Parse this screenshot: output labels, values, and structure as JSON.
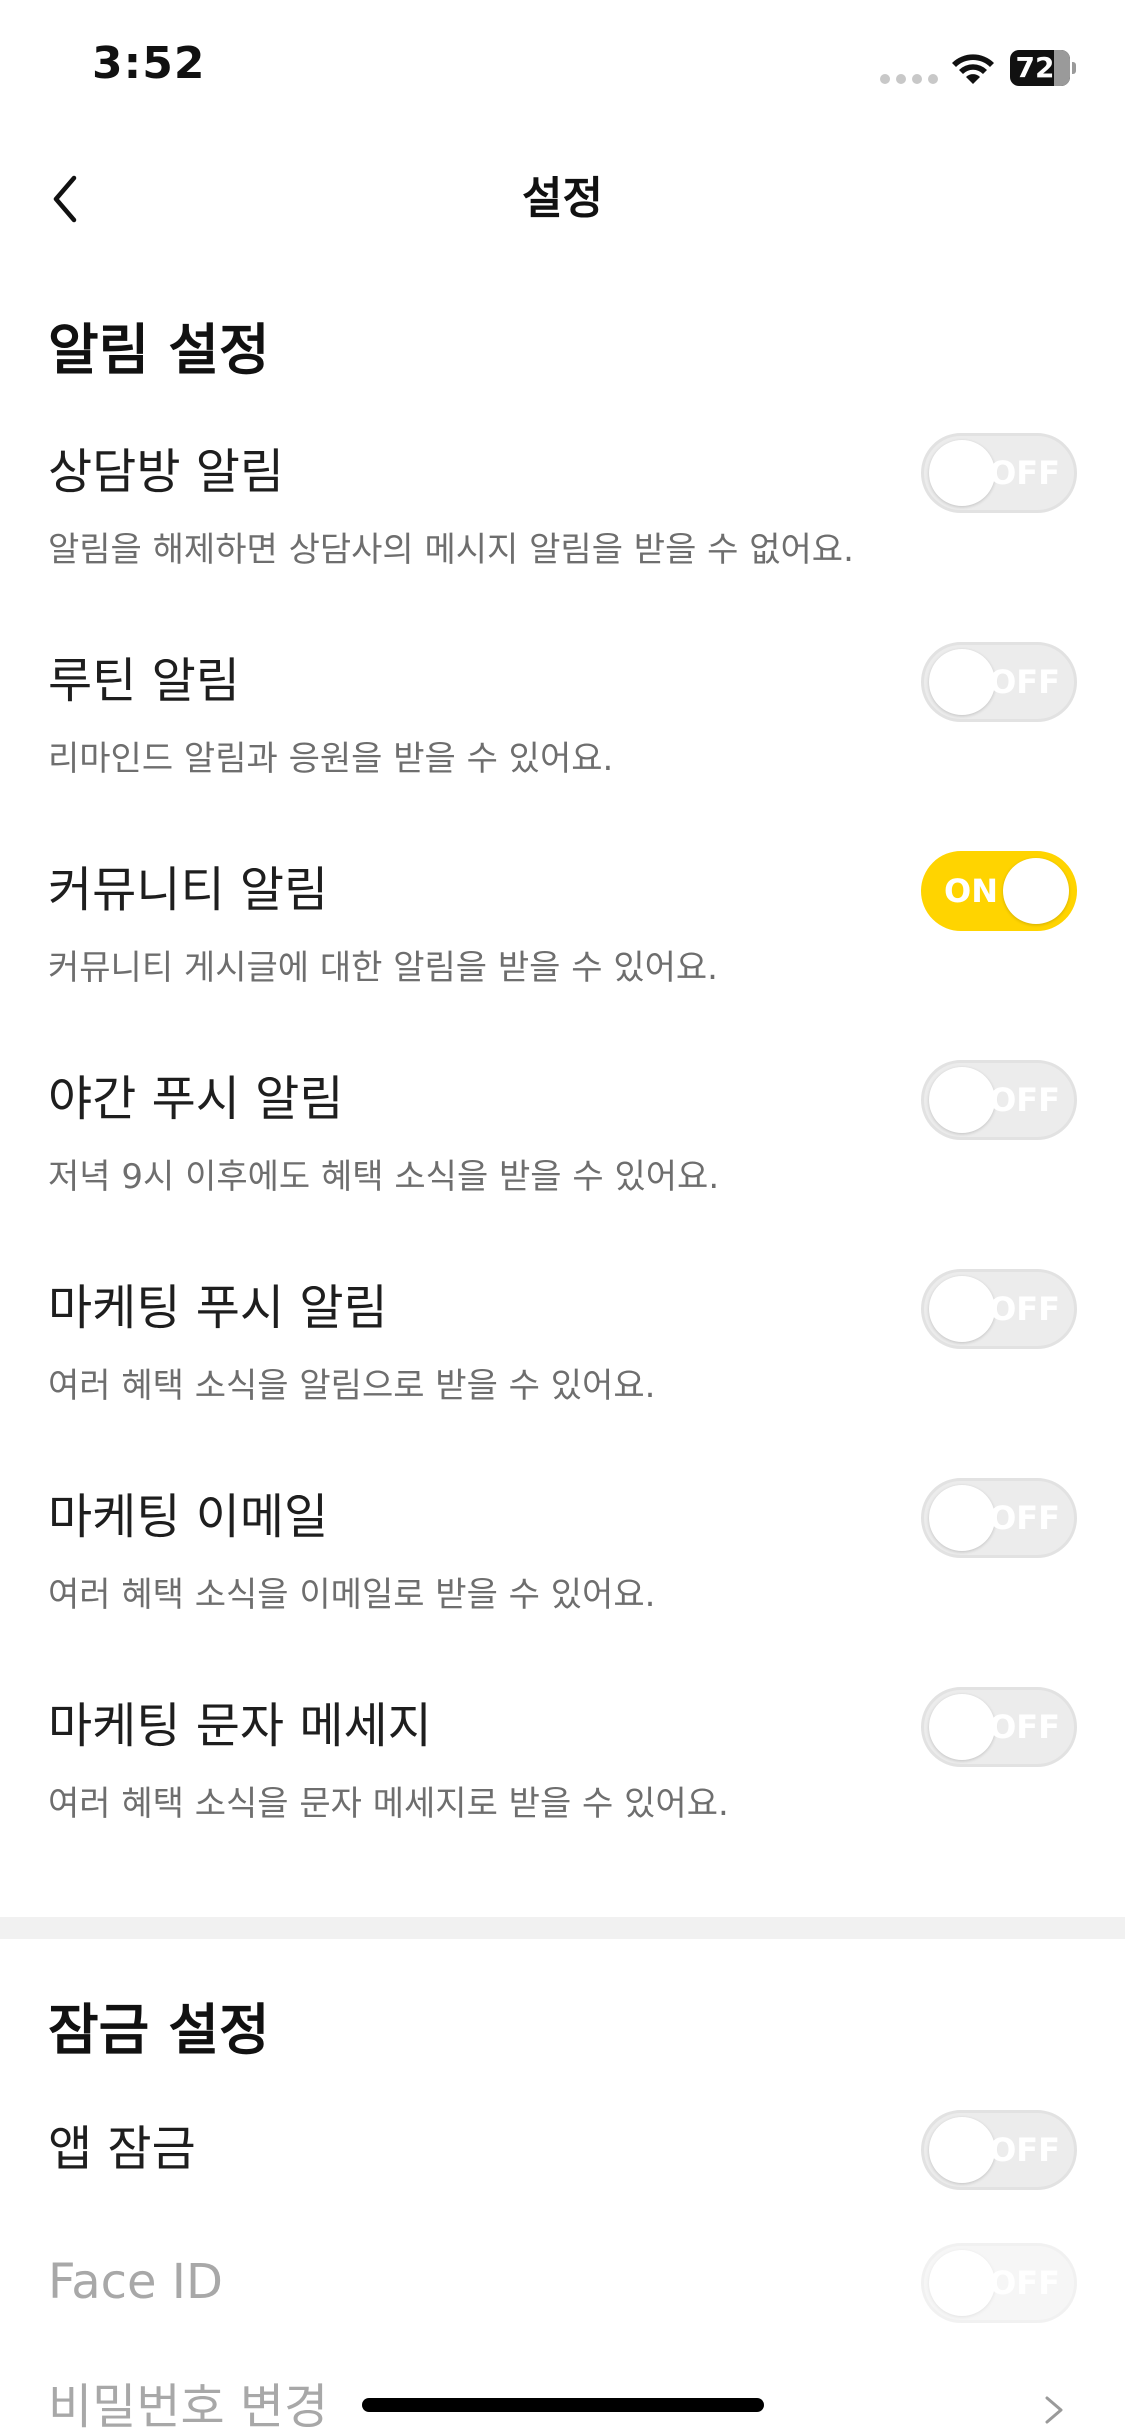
{
  "status": {
    "time": "3:52",
    "battery": "72"
  },
  "nav": {
    "title": "설정"
  },
  "sections": {
    "alerts": {
      "title": "알림 설정"
    },
    "lock": {
      "title": "잠금 설정"
    }
  },
  "alert_rows": [
    {
      "label": "상담방 알림",
      "desc": "알림을 해제하면 상담사의 메시지 알림을 받을 수 없어요.",
      "state": "OFF"
    },
    {
      "label": "루틴 알림",
      "desc": "리마인드 알림과 응원을 받을 수 있어요.",
      "state": "OFF"
    },
    {
      "label": "커뮤니티 알림",
      "desc": "커뮤니티 게시글에 대한 알림을 받을 수 있어요.",
      "state": "ON"
    },
    {
      "label": "야간 푸시 알림",
      "desc": "저녁 9시 이후에도 혜택 소식을 받을 수 있어요.",
      "state": "OFF"
    },
    {
      "label": "마케팅 푸시 알림",
      "desc": "여러 혜택 소식을 알림으로 받을 수 있어요.",
      "state": "OFF"
    },
    {
      "label": "마케팅 이메일",
      "desc": "여러 혜택 소식을 이메일로 받을 수 있어요.",
      "state": "OFF"
    },
    {
      "label": "마케팅 문자 메세지",
      "desc": "여러 혜택 소식을 문자 메세지로 받을 수 있어요.",
      "state": "OFF"
    }
  ],
  "lock_rows": [
    {
      "label": "앱 잠금",
      "state": "OFF"
    },
    {
      "label": "Face ID",
      "state": "OFF"
    },
    {
      "label": "비밀번호 변경"
    }
  ],
  "colors": {
    "toggle_on": "#ffd400",
    "toggle_off": "#ececec",
    "desc_text": "#6e6e6e"
  }
}
